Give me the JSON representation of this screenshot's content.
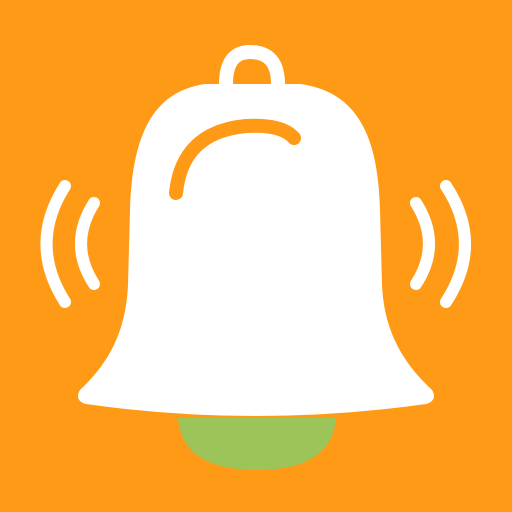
{
  "icon": {
    "name": "ringing-bell-icon",
    "colors": {
      "background": "#FF9A17",
      "bell": "#FFFFFF",
      "clapper": "#9CC459",
      "highlight": "#FF9A17",
      "sound_waves": "#FFFFFF"
    }
  }
}
